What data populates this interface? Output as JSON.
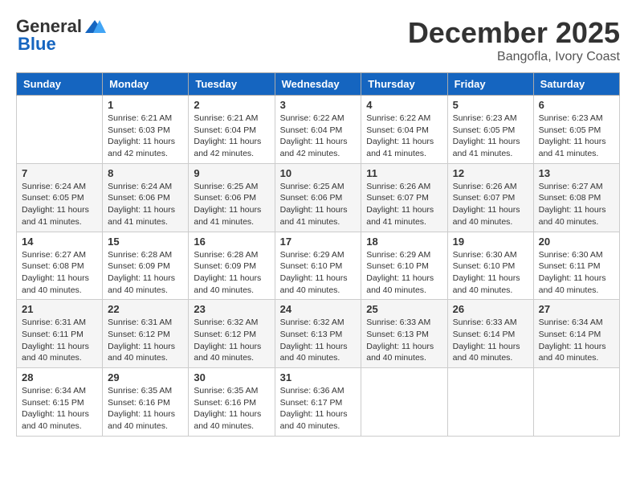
{
  "header": {
    "logo_general": "General",
    "logo_blue": "Blue",
    "month_year": "December 2025",
    "location": "Bangofla, Ivory Coast"
  },
  "weekdays": [
    "Sunday",
    "Monday",
    "Tuesday",
    "Wednesday",
    "Thursday",
    "Friday",
    "Saturday"
  ],
  "weeks": [
    [
      {
        "day": "",
        "info": ""
      },
      {
        "day": "1",
        "info": "Sunrise: 6:21 AM\nSunset: 6:03 PM\nDaylight: 11 hours\nand 42 minutes."
      },
      {
        "day": "2",
        "info": "Sunrise: 6:21 AM\nSunset: 6:04 PM\nDaylight: 11 hours\nand 42 minutes."
      },
      {
        "day": "3",
        "info": "Sunrise: 6:22 AM\nSunset: 6:04 PM\nDaylight: 11 hours\nand 42 minutes."
      },
      {
        "day": "4",
        "info": "Sunrise: 6:22 AM\nSunset: 6:04 PM\nDaylight: 11 hours\nand 41 minutes."
      },
      {
        "day": "5",
        "info": "Sunrise: 6:23 AM\nSunset: 6:05 PM\nDaylight: 11 hours\nand 41 minutes."
      },
      {
        "day": "6",
        "info": "Sunrise: 6:23 AM\nSunset: 6:05 PM\nDaylight: 11 hours\nand 41 minutes."
      }
    ],
    [
      {
        "day": "7",
        "info": "Sunrise: 6:24 AM\nSunset: 6:05 PM\nDaylight: 11 hours\nand 41 minutes."
      },
      {
        "day": "8",
        "info": "Sunrise: 6:24 AM\nSunset: 6:06 PM\nDaylight: 11 hours\nand 41 minutes."
      },
      {
        "day": "9",
        "info": "Sunrise: 6:25 AM\nSunset: 6:06 PM\nDaylight: 11 hours\nand 41 minutes."
      },
      {
        "day": "10",
        "info": "Sunrise: 6:25 AM\nSunset: 6:06 PM\nDaylight: 11 hours\nand 41 minutes."
      },
      {
        "day": "11",
        "info": "Sunrise: 6:26 AM\nSunset: 6:07 PM\nDaylight: 11 hours\nand 41 minutes."
      },
      {
        "day": "12",
        "info": "Sunrise: 6:26 AM\nSunset: 6:07 PM\nDaylight: 11 hours\nand 40 minutes."
      },
      {
        "day": "13",
        "info": "Sunrise: 6:27 AM\nSunset: 6:08 PM\nDaylight: 11 hours\nand 40 minutes."
      }
    ],
    [
      {
        "day": "14",
        "info": "Sunrise: 6:27 AM\nSunset: 6:08 PM\nDaylight: 11 hours\nand 40 minutes."
      },
      {
        "day": "15",
        "info": "Sunrise: 6:28 AM\nSunset: 6:09 PM\nDaylight: 11 hours\nand 40 minutes."
      },
      {
        "day": "16",
        "info": "Sunrise: 6:28 AM\nSunset: 6:09 PM\nDaylight: 11 hours\nand 40 minutes."
      },
      {
        "day": "17",
        "info": "Sunrise: 6:29 AM\nSunset: 6:10 PM\nDaylight: 11 hours\nand 40 minutes."
      },
      {
        "day": "18",
        "info": "Sunrise: 6:29 AM\nSunset: 6:10 PM\nDaylight: 11 hours\nand 40 minutes."
      },
      {
        "day": "19",
        "info": "Sunrise: 6:30 AM\nSunset: 6:10 PM\nDaylight: 11 hours\nand 40 minutes."
      },
      {
        "day": "20",
        "info": "Sunrise: 6:30 AM\nSunset: 6:11 PM\nDaylight: 11 hours\nand 40 minutes."
      }
    ],
    [
      {
        "day": "21",
        "info": "Sunrise: 6:31 AM\nSunset: 6:11 PM\nDaylight: 11 hours\nand 40 minutes."
      },
      {
        "day": "22",
        "info": "Sunrise: 6:31 AM\nSunset: 6:12 PM\nDaylight: 11 hours\nand 40 minutes."
      },
      {
        "day": "23",
        "info": "Sunrise: 6:32 AM\nSunset: 6:12 PM\nDaylight: 11 hours\nand 40 minutes."
      },
      {
        "day": "24",
        "info": "Sunrise: 6:32 AM\nSunset: 6:13 PM\nDaylight: 11 hours\nand 40 minutes."
      },
      {
        "day": "25",
        "info": "Sunrise: 6:33 AM\nSunset: 6:13 PM\nDaylight: 11 hours\nand 40 minutes."
      },
      {
        "day": "26",
        "info": "Sunrise: 6:33 AM\nSunset: 6:14 PM\nDaylight: 11 hours\nand 40 minutes."
      },
      {
        "day": "27",
        "info": "Sunrise: 6:34 AM\nSunset: 6:14 PM\nDaylight: 11 hours\nand 40 minutes."
      }
    ],
    [
      {
        "day": "28",
        "info": "Sunrise: 6:34 AM\nSunset: 6:15 PM\nDaylight: 11 hours\nand 40 minutes."
      },
      {
        "day": "29",
        "info": "Sunrise: 6:35 AM\nSunset: 6:16 PM\nDaylight: 11 hours\nand 40 minutes."
      },
      {
        "day": "30",
        "info": "Sunrise: 6:35 AM\nSunset: 6:16 PM\nDaylight: 11 hours\nand 40 minutes."
      },
      {
        "day": "31",
        "info": "Sunrise: 6:36 AM\nSunset: 6:17 PM\nDaylight: 11 hours\nand 40 minutes."
      },
      {
        "day": "",
        "info": ""
      },
      {
        "day": "",
        "info": ""
      },
      {
        "day": "",
        "info": ""
      }
    ]
  ]
}
